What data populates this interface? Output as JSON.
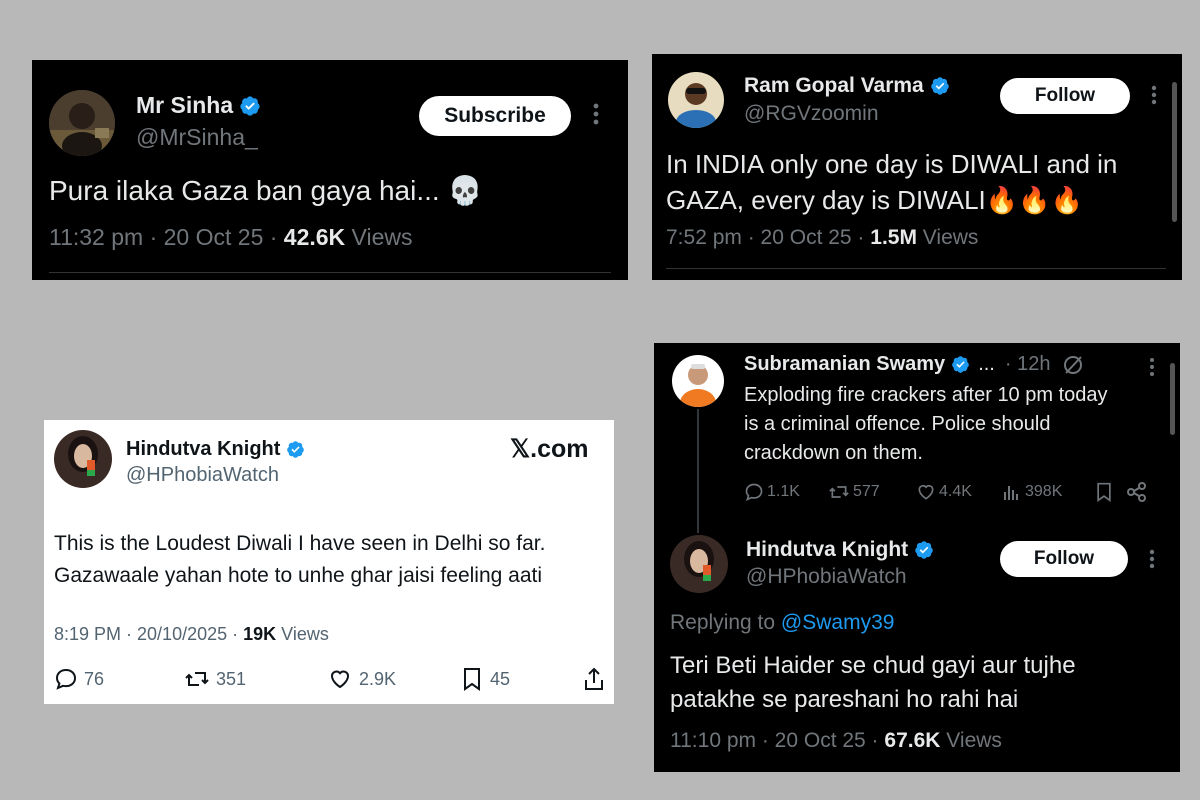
{
  "tweet1": {
    "name": "Mr Sinha",
    "handle": "@MrSinha_",
    "button": "Subscribe",
    "text": "Pura ilaka Gaza ban gaya hai... 💀",
    "time": "11:32 pm · 20 Oct 25 · ",
    "views_count": "42.6K",
    "views_label": " Views"
  },
  "tweet2": {
    "name": "Ram Gopal Varma",
    "handle": "@RGVzoomin",
    "button": "Follow",
    "text": "In INDIA only one day is DIWALI and in\nGAZA, every day is DIWALI🔥🔥🔥",
    "time": "7:52 pm · 20 Oct 25 · ",
    "views_count": "1.5M",
    "views_label": " Views"
  },
  "tweet3": {
    "name": "Hindutva Knight",
    "handle": "@HPhobiaWatch",
    "brand": "𝕏.com",
    "text": "This is the Loudest Diwali I have seen in Delhi so far.\nGazawaale yahan hote to unhe ghar jaisi feeling aati",
    "time": "8:19 PM · 20/10/2025 · ",
    "views_count": "19K",
    "views_label": " Views",
    "replies": "76",
    "reposts": "351",
    "likes": "2.9K",
    "bookmarks": "45"
  },
  "tweet4": {
    "parent": {
      "name": "Subramanian Swamy",
      "ellipsis": "...",
      "time": "· 12h",
      "text": "Exploding fire crackers after 10 pm today\nis a criminal offence. Police should\ncrackdown on them.",
      "replies": "1.1K",
      "reposts": "577",
      "likes": "4.4K",
      "views": "398K"
    },
    "reply": {
      "name": "Hindutva Knight",
      "handle": "@HPhobiaWatch",
      "button": "Follow",
      "replying_prefix": "Replying to ",
      "replying_handle": "@Swamy39",
      "text": "Teri Beti Haider se chud gayi aur tujhe\npatakhe se pareshani ho rahi hai",
      "time": "11:10 pm · 20 Oct 25 · ",
      "views_count": "67.6K",
      "views_label": " Views"
    }
  },
  "colors": {
    "verified": "#1d9bf0",
    "link": "#1d9bf0",
    "dark_bg": "#000000",
    "page_bg": "#b8b8b8"
  }
}
